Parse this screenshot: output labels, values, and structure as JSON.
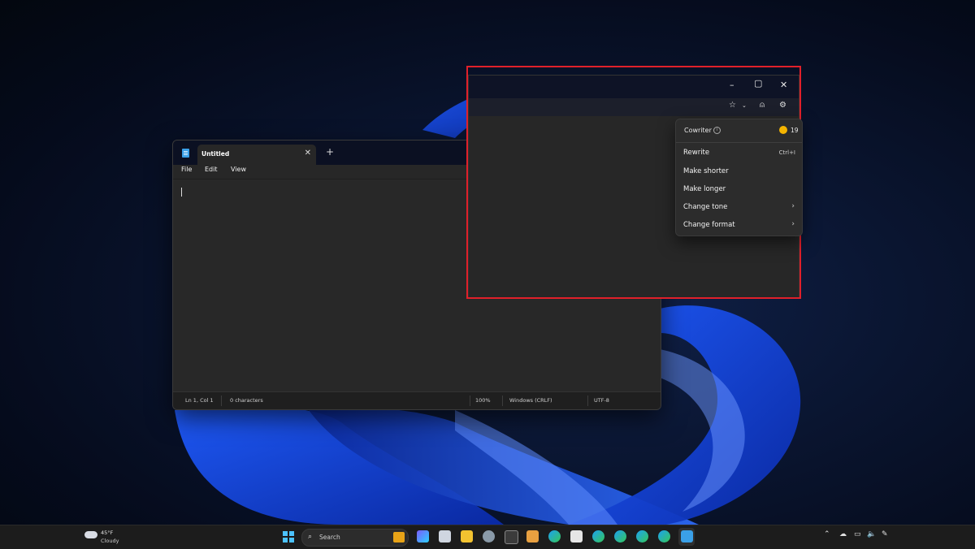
{
  "notepad": {
    "tab_title": "Untitled",
    "menu": [
      "File",
      "Edit",
      "View"
    ],
    "status": {
      "position": "Ln 1, Col 1",
      "characters": "0 characters",
      "zoom": "100%",
      "line_ending": "Windows (CRLF)",
      "encoding": "UTF-8"
    }
  },
  "cowriter": {
    "title": "Cowriter",
    "credits": "19",
    "items": [
      {
        "label": "Rewrite",
        "shortcut": "Ctrl+I"
      },
      {
        "label": "Make shorter"
      },
      {
        "label": "Make longer"
      },
      {
        "label": "Change tone"
      },
      {
        "label": "Change format"
      }
    ]
  },
  "taskbar": {
    "weather_temp": "45°F",
    "weather_desc": "Cloudy",
    "search_label": "Search"
  },
  "colors": {
    "accent": "#4cc2ff",
    "highlight": "#e0202a",
    "coin": "#f4b400"
  }
}
